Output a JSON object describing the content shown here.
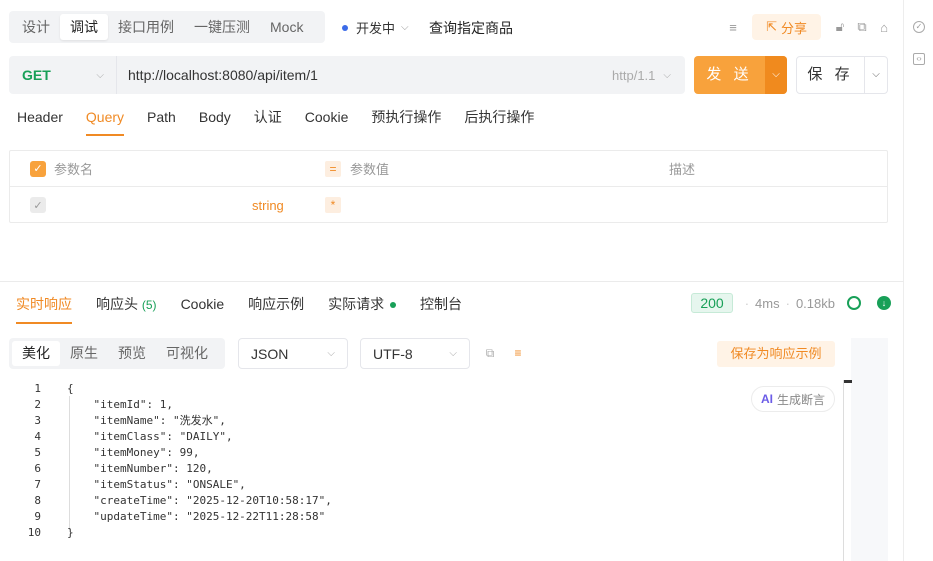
{
  "mode_tabs": [
    {
      "label": "设计",
      "active": false
    },
    {
      "label": "调试",
      "active": true
    },
    {
      "label": "接口用例",
      "active": false
    },
    {
      "label": "一键压测",
      "active": false
    },
    {
      "label": "Mock",
      "active": false
    }
  ],
  "environment": {
    "label": "开发中"
  },
  "request_name": "查询指定商品",
  "share_label": "分享",
  "request": {
    "method": "GET",
    "url": "http://localhost:8080/api/item/1",
    "http_version": "http/1.1"
  },
  "send_label": "发 送",
  "save_label": "保 存",
  "param_tabs": [
    "Header",
    "Query",
    "Path",
    "Body",
    "认证",
    "Cookie",
    "预执行操作",
    "后执行操作"
  ],
  "active_param_tab": "Query",
  "param_table": {
    "headers": {
      "name": "参数名",
      "value": "参数值",
      "desc": "描述"
    },
    "row": {
      "type": "string",
      "value_marker": "*"
    }
  },
  "response_tabs": [
    {
      "label": "实时响应",
      "active": true
    },
    {
      "label": "响应头",
      "count": "(5)"
    },
    {
      "label": "Cookie"
    },
    {
      "label": "响应示例"
    },
    {
      "label": "实际请求",
      "dot": true
    },
    {
      "label": "控制台"
    }
  ],
  "response_status": {
    "code": "200",
    "time": "4ms",
    "size": "0.18kb"
  },
  "view_tabs": [
    {
      "label": "美化",
      "active": true
    },
    {
      "label": "原生"
    },
    {
      "label": "预览"
    },
    {
      "label": "可视化"
    }
  ],
  "format_select": "JSON",
  "encoding_select": "UTF-8",
  "save_example_label": "保存为响应示例",
  "ai_button": {
    "badge": "AI",
    "label": "生成断言"
  },
  "response_body": [
    {
      "num": "1",
      "text": "{"
    },
    {
      "num": "2",
      "text": "    \"itemId\": 1,"
    },
    {
      "num": "3",
      "text": "    \"itemName\": \"洗发水\","
    },
    {
      "num": "4",
      "text": "    \"itemClass\": \"DAILY\","
    },
    {
      "num": "5",
      "text": "    \"itemMoney\": 99,"
    },
    {
      "num": "6",
      "text": "    \"itemNumber\": 120,"
    },
    {
      "num": "7",
      "text": "    \"itemStatus\": \"ONSALE\","
    },
    {
      "num": "8",
      "text": "    \"createTime\": \"2025-12-20T10:58:17\","
    },
    {
      "num": "9",
      "text": "    \"updateTime\": \"2025-12-22T11:28:58\""
    },
    {
      "num": "10",
      "text": "}"
    }
  ],
  "colors": {
    "accent": "#f08a24",
    "send": "#f8a23c",
    "method": "#18a058",
    "status_ok": "#18a058"
  }
}
